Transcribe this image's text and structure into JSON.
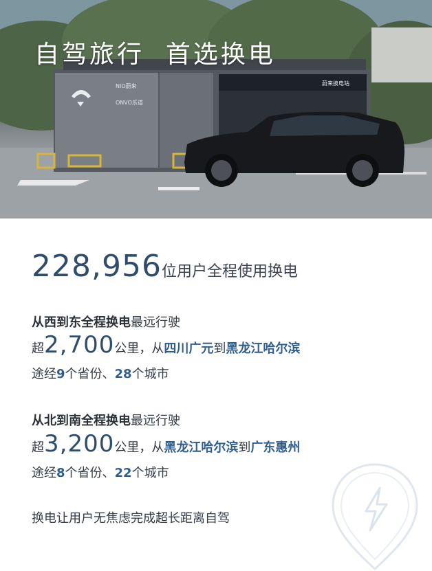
{
  "hero": {
    "title": "自驾旅行  首选换电",
    "station_brand_1": "NIO蔚来",
    "station_brand_2": "ONVO乐道",
    "station_sign": "蔚来换电站"
  },
  "stat": {
    "number": "228,956",
    "label": "位用户全程使用换电"
  },
  "route_west_east": {
    "head_bold": "从西到东全程换电",
    "head_rest": "最远行驶",
    "prefix": "超",
    "distance": "2,700",
    "unit_text": "公里，从",
    "from": "四川广元",
    "to_word": "到",
    "to": "黑龙江哈尔滨",
    "via_1": "途经",
    "provinces": "9",
    "via_2": "个省份、",
    "cities": "28",
    "via_3": "个城市"
  },
  "route_north_south": {
    "head_bold": "从北到南全程换电",
    "head_rest": "最远行驶",
    "prefix": "超",
    "distance": "3,200",
    "unit_text": "公里，从",
    "from": "黑龙江哈尔滨",
    "to_word": "到",
    "to": "广东惠州",
    "via_1": "途经",
    "provinces": "8",
    "via_2": "个省份、",
    "cities": "22",
    "via_3": "个城市"
  },
  "closing": "换电让用户无焦虑完成超长距离自驾",
  "colors": {
    "accent_blue": "#2f5e8e",
    "number_blue": "#2f4d6a",
    "text": "#333b45"
  },
  "icons": [
    "nio-logo-icon",
    "lightning-pin-icon"
  ]
}
